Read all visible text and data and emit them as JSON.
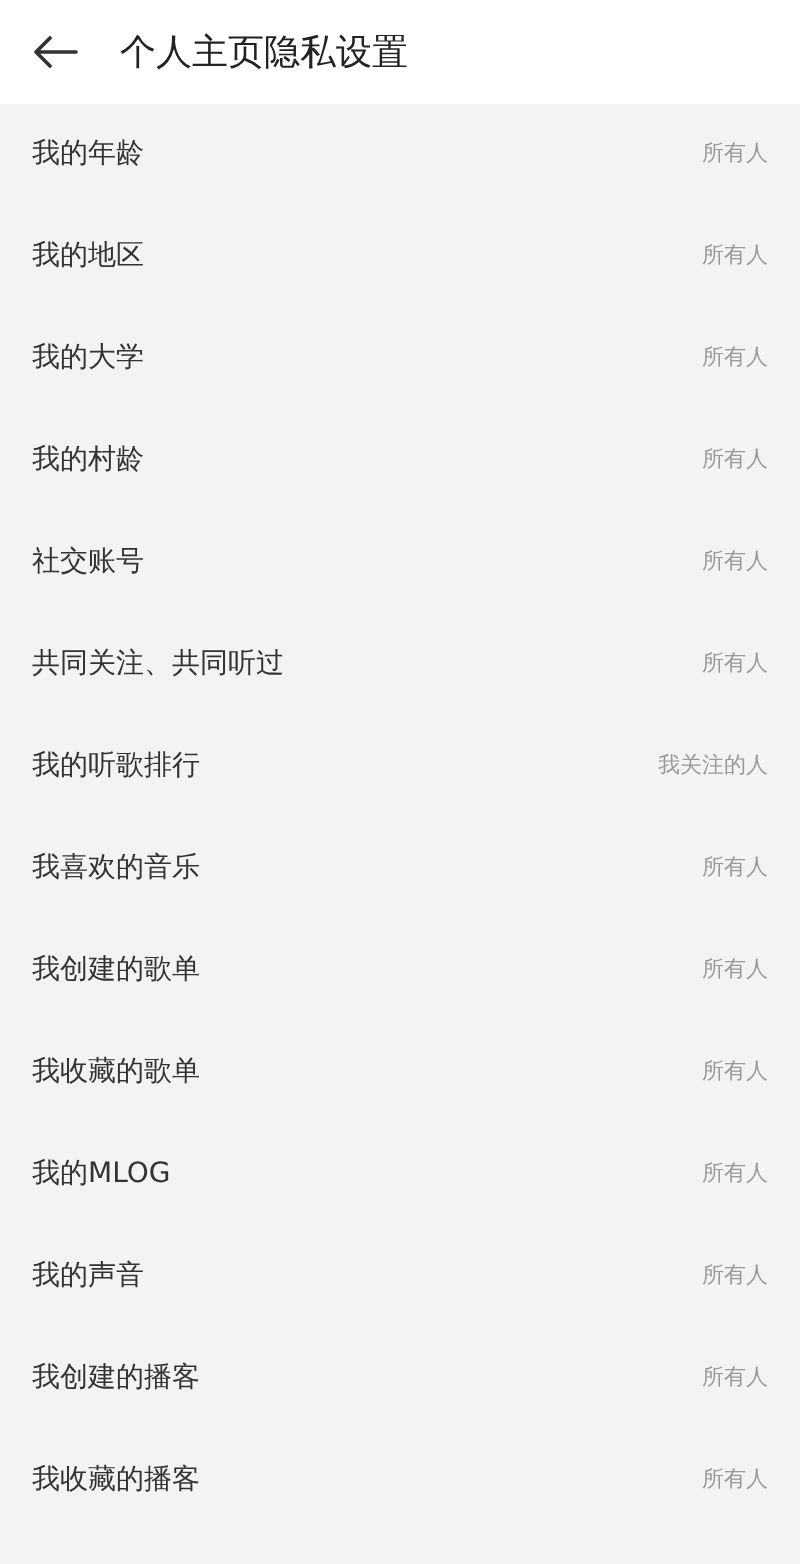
{
  "header": {
    "title": "个人主页隐私设置"
  },
  "items": [
    {
      "label": "我的年龄",
      "value": "所有人"
    },
    {
      "label": "我的地区",
      "value": "所有人"
    },
    {
      "label": "我的大学",
      "value": "所有人"
    },
    {
      "label": "我的村龄",
      "value": "所有人"
    },
    {
      "label": "社交账号",
      "value": "所有人"
    },
    {
      "label": "共同关注、共同听过",
      "value": "所有人"
    },
    {
      "label": "我的听歌排行",
      "value": "我关注的人"
    },
    {
      "label": "我喜欢的音乐",
      "value": "所有人"
    },
    {
      "label": "我创建的歌单",
      "value": "所有人"
    },
    {
      "label": "我收藏的歌单",
      "value": "所有人"
    },
    {
      "label": "我的MLOG",
      "value": "所有人"
    },
    {
      "label": "我的声音",
      "value": "所有人"
    },
    {
      "label": "我创建的播客",
      "value": "所有人"
    },
    {
      "label": "我收藏的播客",
      "value": "所有人"
    }
  ]
}
